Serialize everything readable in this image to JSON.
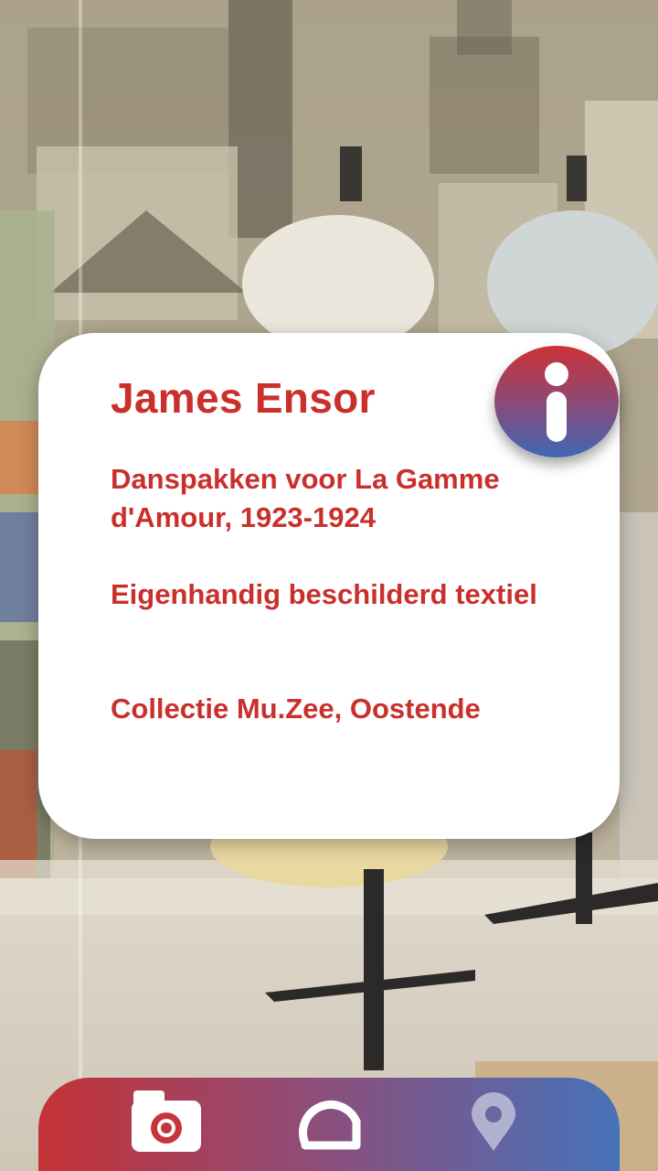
{
  "info_card": {
    "title": "James Ensor",
    "work": "Danspakken voor La Gamme d'Amour, 1923-1924",
    "medium": "Eigenhandig beschilderd textiel",
    "collection": "Collectie Mu.Zee, Oostende"
  },
  "colors": {
    "accent_red": "#c9302c",
    "gradient_start": "#c43236",
    "gradient_end": "#4672ba"
  },
  "icons": {
    "info": "info-icon",
    "camera": "camera-icon",
    "ar": "ar-scan-icon",
    "location": "location-pin-icon"
  },
  "bottom_nav": {
    "active": "camera"
  }
}
